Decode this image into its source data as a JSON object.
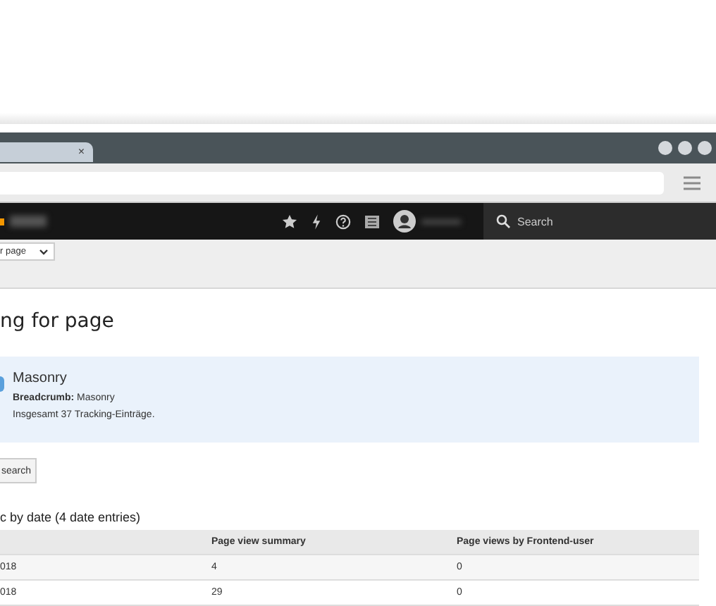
{
  "browser": {
    "tabs": [
      {
        "close": "×",
        "selected": true
      }
    ]
  },
  "topbar": {
    "search": {
      "placeholder": "Search"
    }
  },
  "docheader": {
    "select_value": "r page"
  },
  "heading": "ng for page",
  "info": {
    "title": "Masonry",
    "breadcrumb": "**Breadcrumb:** Masonry",
    "summary": "Insgesamt 37 Tracking-Einträge."
  },
  "search_button": "search",
  "table": {
    "title": "c by date (4 date entries)",
    "columns": [
      "",
      "Page view summary",
      "Page views by Frontend-user"
    ],
    "rows": [
      [
        "018",
        "4",
        "0"
      ],
      [
        "018",
        "29",
        "0"
      ]
    ]
  }
}
